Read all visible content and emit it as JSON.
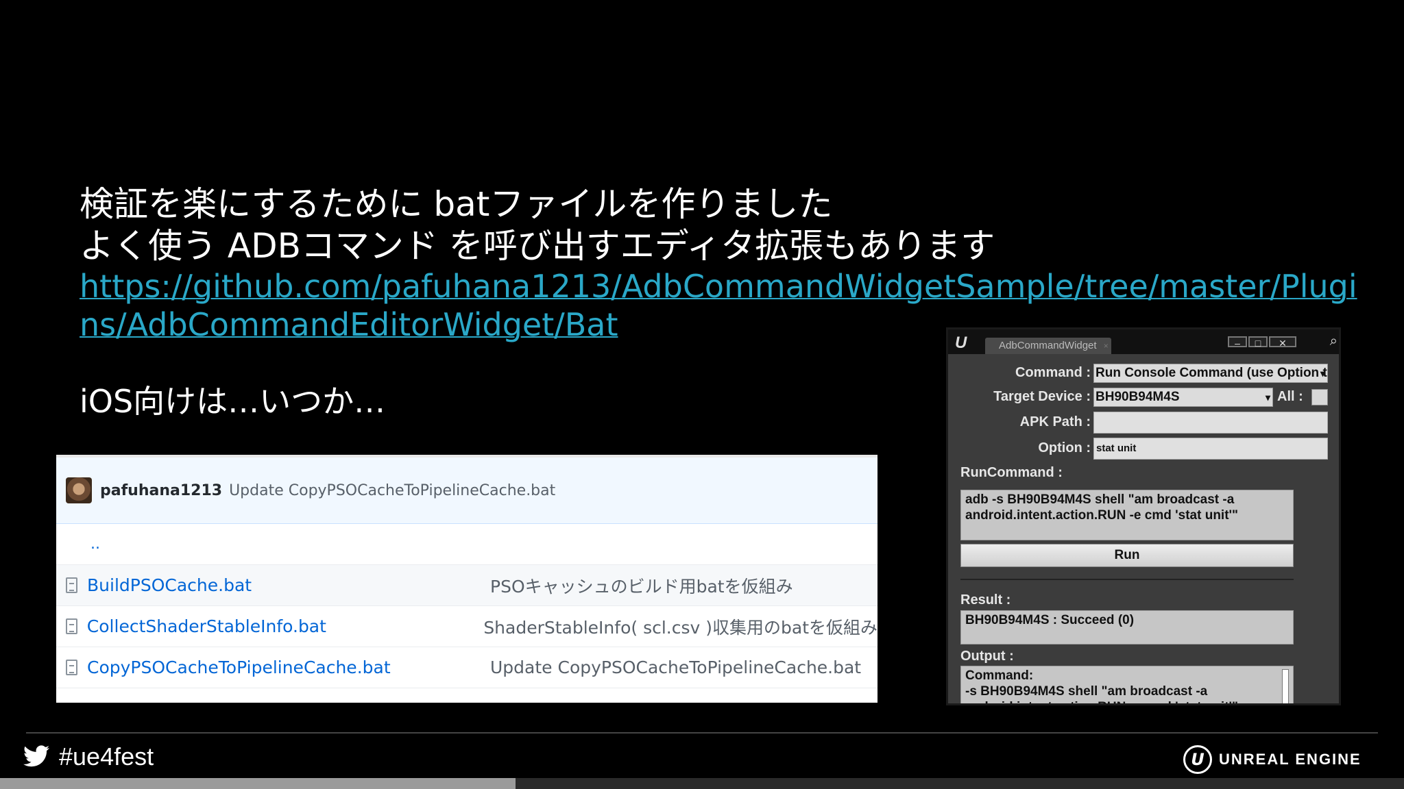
{
  "slide": {
    "line1": "検証を楽にするために batファイルを作りました",
    "line2": "よく使う ADBコマンド を呼び出すエディタ拡張もあります",
    "link_part1": "https://github.com/pafuhana1213/AdbCommandWidgetSample/tree/master/Plugi",
    "link_part2": "ns/AdbCommandEditorWidget/Bat",
    "ios_text": "iOS向けは…いつか…"
  },
  "github": {
    "author": "pafuhana1213",
    "commit_message": "Update CopyPSOCacheToPipelineCache.bat",
    "parent_dir": "..",
    "files": [
      {
        "name": "BuildPSOCache.bat",
        "desc": "PSOキャッシュのビルド用batを仮組み"
      },
      {
        "name": "CollectShaderStableInfo.bat",
        "desc": "ShaderStableInfo( scl.csv )収集用のbatを仮組み"
      },
      {
        "name": "CopyPSOCacheToPipelineCache.bat",
        "desc": "Update CopyPSOCacheToPipelineCache.bat"
      }
    ]
  },
  "widget": {
    "logo": "U",
    "tab_title": "AdbCommandWidget",
    "tab_close": "×",
    "minimize": "–",
    "maximize": "□",
    "close": "✕",
    "search_icon": "search-icon",
    "command_label": "Command :",
    "command_value": "Run Console Command (use Option to",
    "target_label": "Target Device :",
    "target_value": "BH90B94M4S",
    "all_label": "All :",
    "all_checked": false,
    "apk_label": "APK Path :",
    "apk_value": "",
    "option_label": "Option :",
    "option_value": "stat unit",
    "runcommand_label": "RunCommand :",
    "runcommand_value": "adb -s BH90B94M4S shell \"am broadcast -a android.intent.action.RUN -e cmd 'stat unit'\"",
    "run_button": "Run",
    "result_label": "Result :",
    "result_value": "BH90B94M4S : Succeed (0)",
    "output_label": "Output :",
    "output_line1": "Command:",
    "output_line2": "-s BH90B94M4S shell \"am broadcast -a",
    "output_line3": "android.intent.action.RUN -e cmd 'stat unit'\""
  },
  "footer": {
    "hashtag": "#ue4fest",
    "brand": "UNREAL ENGINE",
    "brand_logo": "U",
    "progress_fraction": 0.367
  },
  "colors": {
    "link": "#2aa8c8",
    "background": "#000000"
  }
}
